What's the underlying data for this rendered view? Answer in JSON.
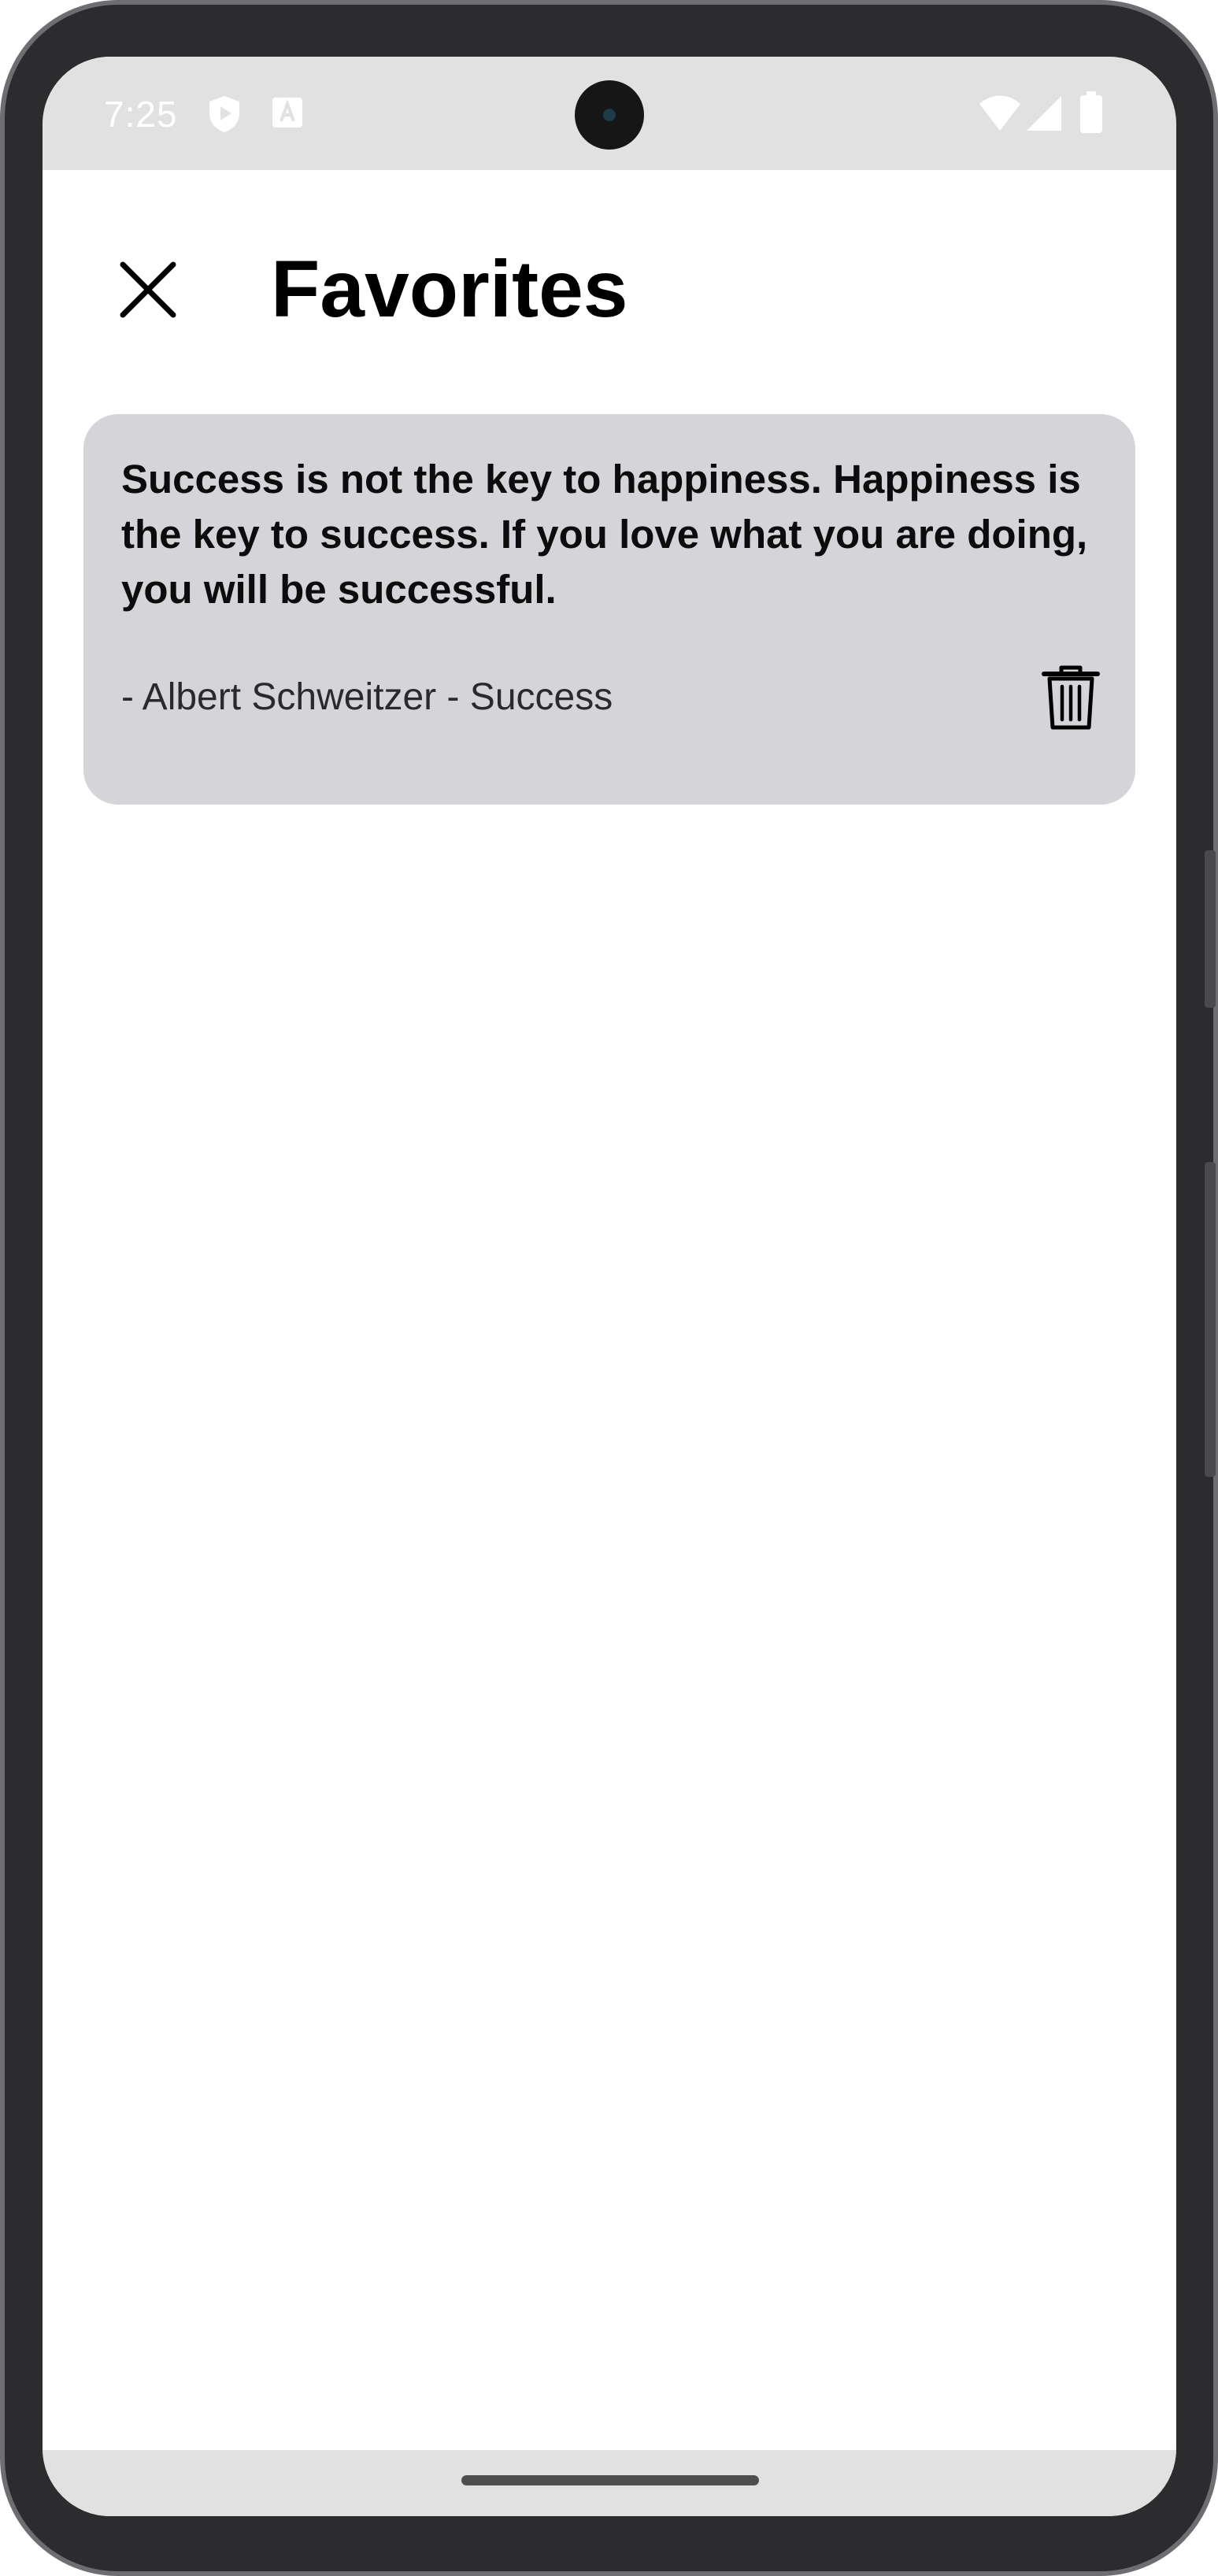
{
  "status_bar": {
    "time": "7:25",
    "left_icons": [
      "shield-play-icon",
      "text-a-icon"
    ],
    "right_icons": [
      "wifi-icon",
      "cell-signal-icon",
      "battery-icon"
    ]
  },
  "header": {
    "title": "Favorites",
    "close_icon": "close-icon"
  },
  "favorites": [
    {
      "quote": "Success is not the key to happiness. Happiness is the key to success. If you love what you are doing, you will be successful.",
      "attribution": "- Albert Schweitzer - Success",
      "delete_icon": "trash-icon"
    }
  ],
  "colors": {
    "card_background": "#d4d4d9",
    "status_bar_background": "#e1e1e1",
    "text_primary": "#000000"
  }
}
